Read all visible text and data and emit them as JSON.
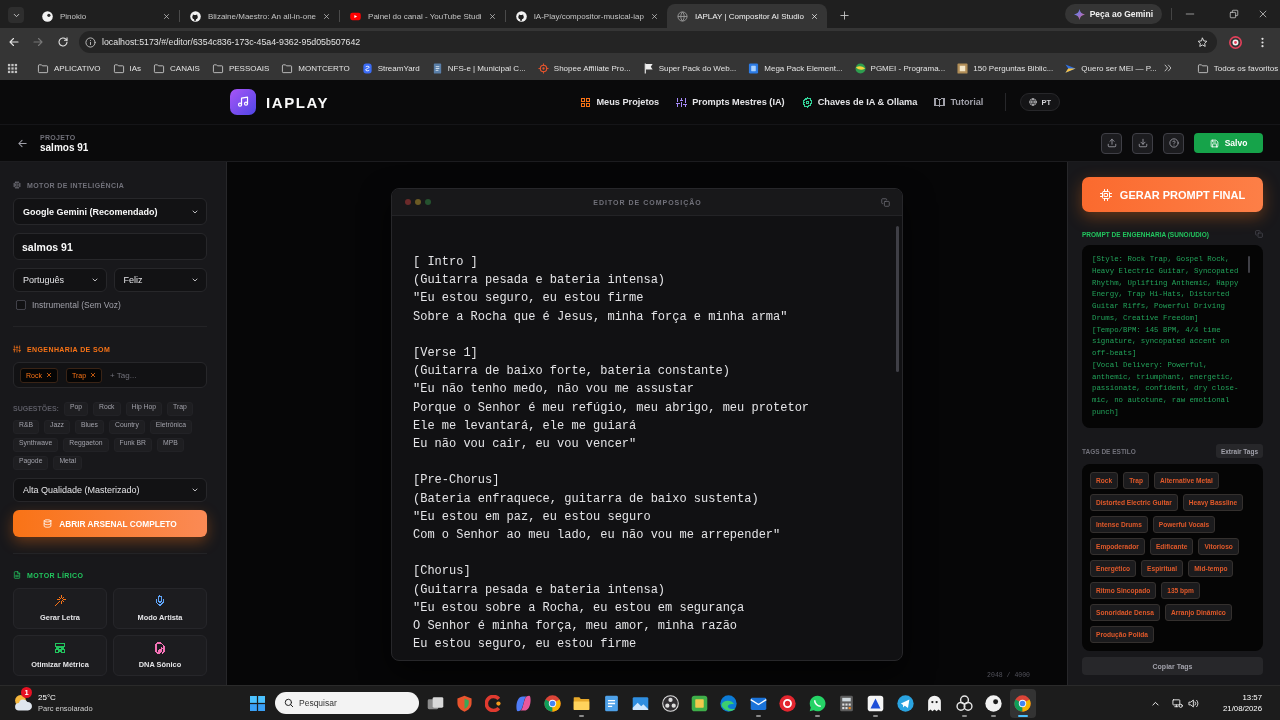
{
  "browser": {
    "tabs": [
      {
        "title": "Pinokio",
        "selected": false
      },
      {
        "title": "Blizaine/Maestro: An all-in-one",
        "selected": false
      },
      {
        "title": "Painel do canal - YouTube Studi",
        "selected": false
      },
      {
        "title": "IA-Play/compositor-musical-iap",
        "selected": false
      },
      {
        "title": "IAPLAY | Compositor AI Studio",
        "selected": true
      }
    ],
    "gemini_button": "Peça ao Gemini",
    "address": "localhost:5173/#/editor/6354c836-173c-45a4-9362-95d05b507642",
    "bookmarks": [
      {
        "label": "APLICATIVO",
        "kind": "folder"
      },
      {
        "label": "IAs",
        "kind": "folder"
      },
      {
        "label": "CANAIS",
        "kind": "folder"
      },
      {
        "label": "PESSOAIS",
        "kind": "folder"
      },
      {
        "label": "MONTCERTO",
        "kind": "folder"
      },
      {
        "label": "StreamYard",
        "kind": "site"
      },
      {
        "label": "NFS-e | Municipal C...",
        "kind": "site"
      },
      {
        "label": "Shopee Affiliate Pro...",
        "kind": "site"
      },
      {
        "label": "Super Pack do Web...",
        "kind": "site"
      },
      {
        "label": "Mega Pack Element...",
        "kind": "site"
      },
      {
        "label": "PGMEI - Programa...",
        "kind": "site"
      },
      {
        "label": "150 Perguntas Biblic...",
        "kind": "site"
      },
      {
        "label": "Quero ser MEI — P...",
        "kind": "site"
      }
    ],
    "all_bookmarks": "Todos os favoritos"
  },
  "app": {
    "logo": "IAPLAY",
    "nav": [
      {
        "label": "Meus Projetos",
        "color": "#f97316"
      },
      {
        "label": "Prompts Mestres (IA)",
        "color": "#a78bfa"
      },
      {
        "label": "Chaves de IA & Ollama",
        "color": "#34d399"
      },
      {
        "label": "Tutorial",
        "color": "#a1a1aa"
      }
    ],
    "language": "PT"
  },
  "project": {
    "caption": "PROJETO",
    "name": "salmos 91",
    "save_button": "Salvo"
  },
  "sidebar": {
    "intelligence": {
      "heading": "MOTOR DE INTELIGÊNCIA",
      "model": "Google Gemini (Recomendado)",
      "title": "salmos 91",
      "language": "Português",
      "mood": "Feliz",
      "instrumental": {
        "label": "Instrumental (Sem Voz)",
        "checked": false
      }
    },
    "sound": {
      "heading": "ENGENHARIA DE SOM",
      "tags": [
        "Rock",
        "Trap"
      ],
      "tag_input": {
        "placeholder": "+ Tag..."
      },
      "suggestions_label": "SUGESTÕES:",
      "suggestions": [
        "Pop",
        "Rock",
        "Hip Hop",
        "Trap",
        "R&B",
        "Jazz",
        "Blues",
        "Country",
        "Eletrônica",
        "Synthwave",
        "Reggaeton",
        "Funk BR",
        "MPB",
        "Pagode",
        "Metal"
      ],
      "quality": "Alta Qualidade (Masterizado)",
      "arsenal_button": "ABRIR ARSENAL COMPLETO"
    },
    "lyric": {
      "heading": "MOTOR LÍRICO",
      "tools": [
        {
          "label": "Gerar Letra",
          "color": "#f97316"
        },
        {
          "label": "Modo Artista",
          "color": "#60a5fa"
        },
        {
          "label": "Otimizar Métrica",
          "color": "#22c55e"
        },
        {
          "label": "DNA Sônico",
          "color": "#f472b6"
        }
      ]
    }
  },
  "editor": {
    "title": "EDITOR DE COMPOSIÇÃO",
    "lyrics": "[ Intro ]\n(Guitarra pesada e bateria intensa)\n\"Eu estou seguro, eu estou firme\nSobre a Rocha que é Jesus, minha força e minha arma\"\n\n[Verse 1]\n(Guitarra de baixo forte, bateria constante)\n\"Eu não tenho medo, não vou me assustar\nPorque o Senhor é meu refúgio, meu abrigo, meu protetor\nEle me levantará, ele me guiará\nEu não vou cair, eu vou vencer\"\n\n[Pre-Chorus]\n(Bateria enfraquece, guitarra de baixo sustenta)\n\"Eu estou em paz, eu estou seguro\nCom o Senhor ao meu lado, eu não vou me arrepender\"\n\n[Chorus]\n(Guitarra pesada e bateria intensa)\n\"Eu estou sobre a Rocha, eu estou em segurança\nO Senhor é minha força, meu amor, minha razão\nEu estou seguro, eu estou firme",
    "counter": "2048 / 4000"
  },
  "prompt_panel": {
    "generate_button": "GERAR PROMPT FINAL",
    "prompt_heading": "PROMPT DE ENGENHARIA (SUNO/UDIO)",
    "prompt": "[Style: Rock Trap, Gospel Rock, Heavy Electric Guitar, Syncopated Rhythm, Uplifting Anthemic, Happy Energy, Trap Hi-Hats, Distorted Guitar Riffs, Powerful Driving Drums, Creative Freedom]\n[Tempo/BPM: 145 BPM, 4/4 time signature, syncopated accent on off-beats]\n[Vocal Delivery: Powerful, anthemic, triumphant, energetic, passionate, confident, dry close-mic, no autotune, raw emotional punch]",
    "tags_heading": "TAGS DE ESTILO",
    "extract_button": "Extrair Tags",
    "style_tags": [
      "Rock",
      "Trap",
      "Alternative Metal",
      "Distorted Electric Guitar",
      "Heavy Bassline",
      "Intense Drums",
      "Powerful Vocais",
      "Empoderador",
      "Edificante",
      "Vitorioso",
      "Energético",
      "Espiritual",
      "Mid-tempo",
      "Ritmo Sincopado",
      "135 bpm",
      "Sonoridade Densa",
      "Arranjo Dinâmico",
      "Produção Polida"
    ],
    "copy_tags_button": "Copiar Tags"
  },
  "taskbar": {
    "weather": {
      "badge": "1",
      "temperature": "25°C",
      "condition": "Parc ensolarado"
    },
    "search": {
      "placeholder": "Pesquisar"
    },
    "apps": [
      {
        "running": false,
        "selected": false
      },
      {
        "running": false,
        "selected": false
      },
      {
        "running": false,
        "selected": false
      },
      {
        "running": false,
        "selected": false
      },
      {
        "running": false,
        "selected": false
      },
      {
        "running": true,
        "selected": false
      },
      {
        "running": false,
        "selected": false
      },
      {
        "running": false,
        "selected": false
      },
      {
        "running": false,
        "selected": false
      },
      {
        "running": false,
        "selected": false
      },
      {
        "running": false,
        "selected": false
      },
      {
        "running": true,
        "selected": false
      },
      {
        "running": false,
        "selected": false
      },
      {
        "running": true,
        "selected": false
      },
      {
        "running": false,
        "selected": false
      },
      {
        "running": true,
        "selected": false
      },
      {
        "running": false,
        "selected": false
      },
      {
        "running": false,
        "selected": false
      },
      {
        "running": true,
        "selected": false
      },
      {
        "running": true,
        "selected": false
      },
      {
        "running": true,
        "selected": true
      }
    ],
    "time": "13:57",
    "date": "21/08/2026"
  }
}
